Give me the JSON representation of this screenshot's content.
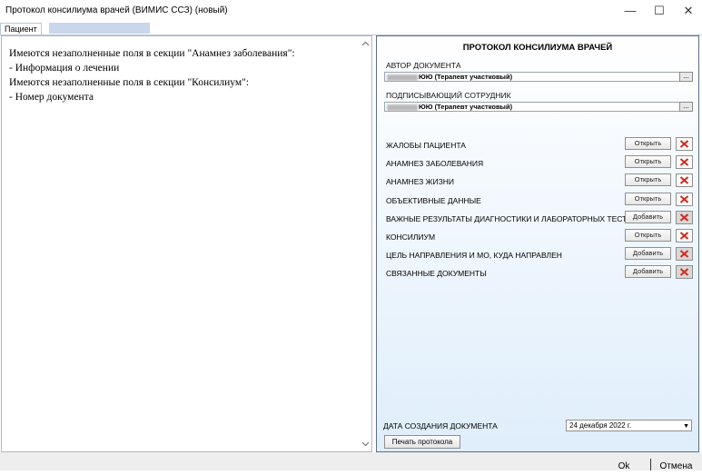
{
  "window": {
    "title": "Протокол консилиума врачей (ВИМИС ССЗ) (новый)",
    "controls": [
      "—",
      "☐",
      "✕"
    ]
  },
  "tabs": {
    "active": "Пациент"
  },
  "left": {
    "lines": [
      "Имеются незаполненные поля в секции \"Анамнез заболевания\":",
      "- Информация о лечении",
      "Имеются незаполненные поля в секции \"Консилиум\":",
      "- Номер документа"
    ]
  },
  "panel": {
    "title": "ПРОТОКОЛ КОНСИЛИУМА ВРАЧЕЙ",
    "author_label": "АВТОР ДОКУМЕНТА",
    "author_value": "(Терапевт участковый)",
    "author_suffix": "ЮЮ",
    "signer_label": "ПОДПИСЫВАЮЩИЙ СОТРУДНИК",
    "signer_value": "(Терапевт участковый)",
    "signer_suffix": "ЮЮ",
    "browse": "...",
    "sections": [
      {
        "label": "ЖАЛОБЫ ПАЦИЕНТА",
        "action": "Открыть",
        "delete_disabled": false
      },
      {
        "label": "АНАМНЕЗ ЗАБОЛЕВАНИЯ",
        "action": "Открыть",
        "delete_disabled": false
      },
      {
        "label": "АНАМНЕЗ ЖИЗНИ",
        "action": "Открыть",
        "delete_disabled": false
      },
      {
        "label": "ОБЪЕКТИВНЫЕ ДАННЫЕ",
        "action": "Открыть",
        "delete_disabled": false
      },
      {
        "label": "ВАЖНЫЕ РЕЗУЛЬТАТЫ ДИАГНОСТИКИ И ЛАБОРАТОРНЫХ ТЕСТОВ",
        "action": "Добавить",
        "delete_disabled": true
      },
      {
        "label": "КОНСИЛИУМ",
        "action": "Открыть",
        "delete_disabled": false
      },
      {
        "label": "ЦЕЛЬ НАПРАВЛЕНИЯ И МО, КУДА НАПРАВЛЕН",
        "action": "Добавить",
        "delete_disabled": true
      },
      {
        "label": "СВЯЗАННЫЕ ДОКУМЕНТЫ",
        "action": "Добавить",
        "delete_disabled": true
      }
    ],
    "date_label": "ДАТА СОЗДАНИЯ ДОКУМЕНТА",
    "date_value": "24 декабря  2022 г.",
    "print_label": "Печать протокола"
  },
  "footer": {
    "ok": "Ok",
    "cancel": "Отмена"
  },
  "colors": {
    "panel_border": "#5c6e88",
    "delete_icon": "#d42a1e",
    "tab_highlight": "#c9d6ec"
  },
  "icons": {
    "delete": "red-x-icon",
    "dropdown": "chevron-down-icon",
    "scroll_up": "chevron-up-icon",
    "scroll_down": "chevron-down-icon"
  }
}
